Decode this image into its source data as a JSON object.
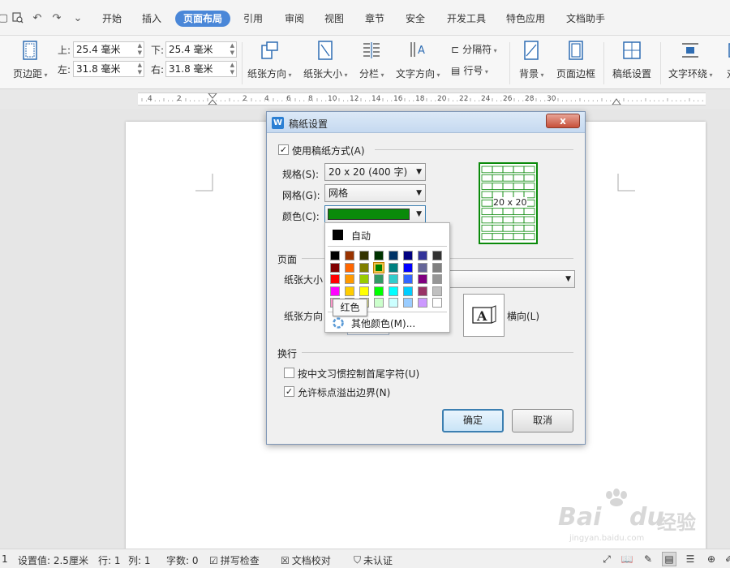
{
  "menubar": {
    "tabs": [
      {
        "label": "开始",
        "active": false
      },
      {
        "label": "插入",
        "active": false
      },
      {
        "label": "页面布局",
        "active": true
      },
      {
        "label": "引用",
        "active": false
      },
      {
        "label": "审阅",
        "active": false
      },
      {
        "label": "视图",
        "active": false
      },
      {
        "label": "章节",
        "active": false
      },
      {
        "label": "安全",
        "active": false
      },
      {
        "label": "开发工具",
        "active": false
      },
      {
        "label": "特色应用",
        "active": false
      },
      {
        "label": "文档助手",
        "active": false
      }
    ],
    "quick_icons": [
      "search-preview-icon",
      "undo-icon",
      "redo-icon",
      "customize-dropdown-icon"
    ]
  },
  "ribbon": {
    "margins_label": "页边距",
    "top_label": "上:",
    "top_value": "25.4 毫米",
    "bottom_label": "下:",
    "bottom_value": "25.4 毫米",
    "left_label": "左:",
    "left_value": "31.8 毫米",
    "right_label": "右:",
    "right_value": "31.8 毫米",
    "orientation_label": "纸张方向",
    "size_label": "纸张大小",
    "columns_label": "分栏",
    "text_direction_label": "文字方向",
    "separator_label": "分隔符",
    "line_number_label": "行号",
    "background_label": "背景",
    "page_border_label": "页面边框",
    "manuscript_label": "稿纸设置",
    "text_wrap_label": "文字环绕",
    "cut_label": "对"
  },
  "ruler": {
    "labels": [
      "4",
      "2",
      "2",
      "4",
      "6",
      "8",
      "10",
      "12",
      "14",
      "16",
      "18",
      "20",
      "22",
      "24",
      "26",
      "28",
      "30"
    ]
  },
  "dialog": {
    "title": "稿纸设置",
    "close_label": "x",
    "use_manuscript_label": "使用稿纸方式(A)",
    "use_manuscript_checked": true,
    "spec_label": "规格(S):",
    "spec_value": "20 x 20 (400 字)",
    "grid_label": "网格(G):",
    "grid_value": "网格",
    "color_label": "颜色(C):",
    "color_value_hex": "#0a8a0a",
    "preview_label": "20 x 20",
    "page_section_label": "页面",
    "paper_size_label": "纸张大小",
    "paper_orientation_label": "纸张方向",
    "landscape_label": "横向(L)",
    "line_break_section_label": "换行",
    "cjk_control_label": "按中文习惯控制首尾字符(U)",
    "cjk_control_checked": false,
    "allow_punct_label": "允许标点溢出边界(N)",
    "allow_punct_checked": true,
    "ok_label": "确定",
    "cancel_label": "取消"
  },
  "color_popup": {
    "auto_label": "自动",
    "more_colors_label": "其他颜色(M)...",
    "tooltip": "红色",
    "selected_hex": "#0a8a0a",
    "rows": [
      [
        "#000000",
        "#993300",
        "#333300",
        "#003300",
        "#003366",
        "#000080",
        "#333399",
        "#333333"
      ],
      [
        "#800000",
        "#ff6600",
        "#808000",
        "#008000",
        "#008080",
        "#0000ff",
        "#666699",
        "#808080"
      ],
      [
        "#ff0000",
        "#ff9900",
        "#99cc00",
        "#339966",
        "#33cccc",
        "#3366ff",
        "#800080",
        "#969696"
      ],
      [
        "#ff00ff",
        "#ffcc00",
        "#ffff00",
        "#00ff00",
        "#00ffff",
        "#00ccff",
        "#993366",
        "#c0c0c0"
      ],
      [
        "#ff99cc",
        "#ffcc99",
        "#ffff99",
        "#ccffcc",
        "#ccffff",
        "#99ccff",
        "#cc99ff",
        "#ffffff"
      ]
    ]
  },
  "statusbar": {
    "page": "1",
    "setting": "设置值: 2.5厘米",
    "row": "行: 1",
    "col": "列: 1",
    "words": "字数: 0",
    "spell": "拼写检查",
    "proof": "文档校对",
    "auth": "未认证"
  },
  "watermark": {
    "brand": "Bai",
    "brand2": "du",
    "cn": "经验",
    "url": "jingyan.baidu.com"
  }
}
